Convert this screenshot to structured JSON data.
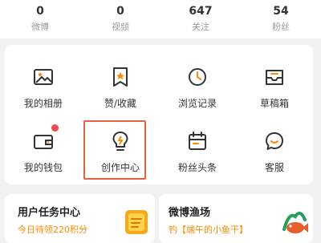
{
  "stats": [
    {
      "num": "0",
      "label": "微博"
    },
    {
      "num": "0",
      "label": "视频"
    },
    {
      "num": "647",
      "label": "关注"
    },
    {
      "num": "54",
      "label": "粉丝"
    }
  ],
  "grid": [
    {
      "icon": "photo-album-icon",
      "label": "我的相册"
    },
    {
      "icon": "favorite-badge-icon",
      "label": "赞/收藏"
    },
    {
      "icon": "history-clock-icon",
      "label": "浏览记录"
    },
    {
      "icon": "drafts-tray-icon",
      "label": "草稿箱"
    },
    {
      "icon": "wallet-icon",
      "label": "我的钱包"
    },
    {
      "icon": "lightbulb-icon",
      "label": "创作中心"
    },
    {
      "icon": "calendar-icon",
      "label": "粉丝头条"
    },
    {
      "icon": "chat-smile-icon",
      "label": "客服"
    }
  ],
  "cards": [
    {
      "title": "用户任务中心",
      "sub": "今日待领220积分"
    },
    {
      "title": "微博渔场",
      "sub": "钓【端午的小鱼干】"
    }
  ],
  "colors": {
    "accent": "#ff8a00",
    "highlight": "#e8613f",
    "badge": "#f04848"
  }
}
